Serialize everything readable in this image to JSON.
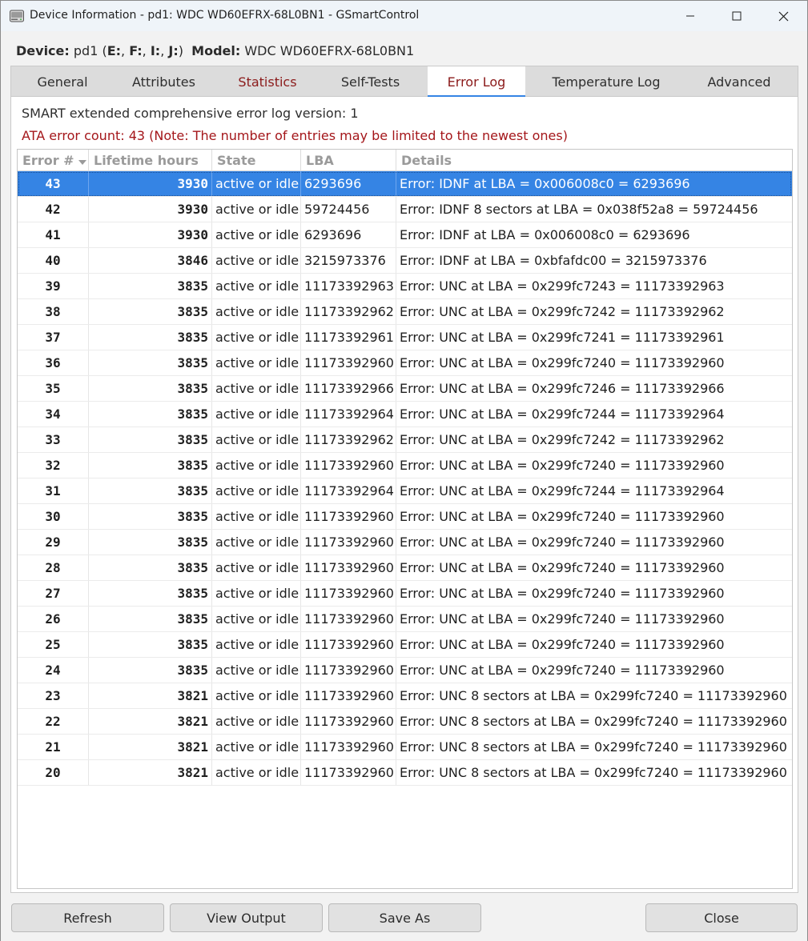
{
  "window": {
    "title": "Device Information - pd1: WDC WD60EFRX-68L0BN1 - GSmartControl"
  },
  "device": {
    "device_label": "Device:",
    "device_name": "pd1",
    "drives": "E:, F:, I:, J:",
    "model_label": "Model:",
    "model_value": "WDC WD60EFRX-68L0BN1"
  },
  "tabs": [
    {
      "label": "General",
      "warn": false,
      "active": false
    },
    {
      "label": "Attributes",
      "warn": false,
      "active": false
    },
    {
      "label": "Statistics",
      "warn": true,
      "active": false
    },
    {
      "label": "Self-Tests",
      "warn": false,
      "active": false
    },
    {
      "label": "Error Log",
      "warn": true,
      "active": true
    },
    {
      "label": "Temperature Log",
      "warn": false,
      "active": false
    },
    {
      "label": "Advanced",
      "warn": false,
      "active": false
    }
  ],
  "errorlog": {
    "version_text": "SMART extended comprehensive error log version: 1",
    "count_text": "ATA error count: 43 (Note: The number of entries may be limited to the newest ones)",
    "columns": [
      "Error #",
      "Lifetime hours",
      "State",
      "LBA",
      "Details"
    ],
    "sort_column": "Error #",
    "rows": [
      {
        "num": "43",
        "hours": "3930",
        "state": "active or idle",
        "lba": "6293696",
        "details": "Error: IDNF at LBA = 0x006008c0 = 6293696",
        "selected": true
      },
      {
        "num": "42",
        "hours": "3930",
        "state": "active or idle",
        "lba": "59724456",
        "details": "Error: IDNF 8 sectors at LBA = 0x038f52a8 = 59724456"
      },
      {
        "num": "41",
        "hours": "3930",
        "state": "active or idle",
        "lba": "6293696",
        "details": "Error: IDNF at LBA = 0x006008c0 = 6293696"
      },
      {
        "num": "40",
        "hours": "3846",
        "state": "active or idle",
        "lba": "3215973376",
        "details": "Error: IDNF at LBA = 0xbfafdc00 = 3215973376"
      },
      {
        "num": "39",
        "hours": "3835",
        "state": "active or idle",
        "lba": "11173392963",
        "details": "Error: UNC at LBA = 0x299fc7243 = 11173392963"
      },
      {
        "num": "38",
        "hours": "3835",
        "state": "active or idle",
        "lba": "11173392962",
        "details": "Error: UNC at LBA = 0x299fc7242 = 11173392962"
      },
      {
        "num": "37",
        "hours": "3835",
        "state": "active or idle",
        "lba": "11173392961",
        "details": "Error: UNC at LBA = 0x299fc7241 = 11173392961"
      },
      {
        "num": "36",
        "hours": "3835",
        "state": "active or idle",
        "lba": "11173392960",
        "details": "Error: UNC at LBA = 0x299fc7240 = 11173392960"
      },
      {
        "num": "35",
        "hours": "3835",
        "state": "active or idle",
        "lba": "11173392966",
        "details": "Error: UNC at LBA = 0x299fc7246 = 11173392966"
      },
      {
        "num": "34",
        "hours": "3835",
        "state": "active or idle",
        "lba": "11173392964",
        "details": "Error: UNC at LBA = 0x299fc7244 = 11173392964"
      },
      {
        "num": "33",
        "hours": "3835",
        "state": "active or idle",
        "lba": "11173392962",
        "details": "Error: UNC at LBA = 0x299fc7242 = 11173392962"
      },
      {
        "num": "32",
        "hours": "3835",
        "state": "active or idle",
        "lba": "11173392960",
        "details": "Error: UNC at LBA = 0x299fc7240 = 11173392960"
      },
      {
        "num": "31",
        "hours": "3835",
        "state": "active or idle",
        "lba": "11173392964",
        "details": "Error: UNC at LBA = 0x299fc7244 = 11173392964"
      },
      {
        "num": "30",
        "hours": "3835",
        "state": "active or idle",
        "lba": "11173392960",
        "details": "Error: UNC at LBA = 0x299fc7240 = 11173392960"
      },
      {
        "num": "29",
        "hours": "3835",
        "state": "active or idle",
        "lba": "11173392960",
        "details": "Error: UNC at LBA = 0x299fc7240 = 11173392960"
      },
      {
        "num": "28",
        "hours": "3835",
        "state": "active or idle",
        "lba": "11173392960",
        "details": "Error: UNC at LBA = 0x299fc7240 = 11173392960"
      },
      {
        "num": "27",
        "hours": "3835",
        "state": "active or idle",
        "lba": "11173392960",
        "details": "Error: UNC at LBA = 0x299fc7240 = 11173392960"
      },
      {
        "num": "26",
        "hours": "3835",
        "state": "active or idle",
        "lba": "11173392960",
        "details": "Error: UNC at LBA = 0x299fc7240 = 11173392960"
      },
      {
        "num": "25",
        "hours": "3835",
        "state": "active or idle",
        "lba": "11173392960",
        "details": "Error: UNC at LBA = 0x299fc7240 = 11173392960"
      },
      {
        "num": "24",
        "hours": "3835",
        "state": "active or idle",
        "lba": "11173392960",
        "details": "Error: UNC at LBA = 0x299fc7240 = 11173392960"
      },
      {
        "num": "23",
        "hours": "3821",
        "state": "active or idle",
        "lba": "11173392960",
        "details": "Error: UNC 8 sectors at LBA = 0x299fc7240 = 11173392960"
      },
      {
        "num": "22",
        "hours": "3821",
        "state": "active or idle",
        "lba": "11173392960",
        "details": "Error: UNC 8 sectors at LBA = 0x299fc7240 = 11173392960"
      },
      {
        "num": "21",
        "hours": "3821",
        "state": "active or idle",
        "lba": "11173392960",
        "details": "Error: UNC 8 sectors at LBA = 0x299fc7240 = 11173392960"
      },
      {
        "num": "20",
        "hours": "3821",
        "state": "active or idle",
        "lba": "11173392960",
        "details": "Error: UNC 8 sectors at LBA = 0x299fc7240 = 11173392960"
      }
    ]
  },
  "buttons": {
    "refresh": "Refresh",
    "view_output": "View Output",
    "save_as": "Save As",
    "close": "Close"
  },
  "colors": {
    "accent": "#3584e4",
    "warning_text": "#a4161a",
    "tab_warning_text": "#8b1a1a"
  },
  "icons": {
    "app": "hard-drive-icon",
    "minimize": "minimize-icon",
    "maximize": "maximize-icon",
    "close": "close-icon",
    "sort": "sort-descending-icon"
  }
}
